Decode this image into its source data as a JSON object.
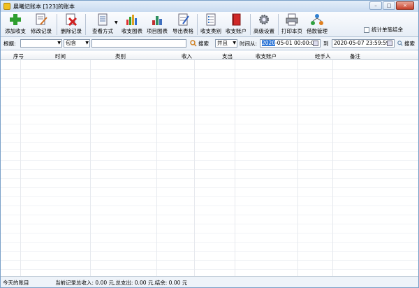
{
  "window": {
    "title": "晨曦记账本  [123]的账本",
    "buttons": {
      "minimize": "–",
      "maximize": "□",
      "close": "×"
    }
  },
  "toolbar": {
    "items": [
      {
        "label": "添加收支",
        "icon": "add-plus-icon"
      },
      {
        "label": "修改记录",
        "icon": "edit-record-icon"
      },
      {
        "label": "删除记录",
        "icon": "delete-record-icon"
      },
      {
        "label": "查看方式",
        "icon": "view-mode-icon"
      },
      {
        "label": "收支图表",
        "icon": "bar-chart-icon"
      },
      {
        "label": "项目图表",
        "icon": "item-chart-icon"
      },
      {
        "label": "导出表格",
        "icon": "export-table-icon"
      },
      {
        "label": "收支类别",
        "icon": "category-icon"
      },
      {
        "label": "收支账户",
        "icon": "account-book-icon"
      },
      {
        "label": "高级设置",
        "icon": "gear-icon"
      },
      {
        "label": "打印本页",
        "icon": "printer-icon"
      },
      {
        "label": "借款管理",
        "icon": "loan-network-icon"
      }
    ],
    "stat_checkbox_label": "统计单笔结余"
  },
  "filter": {
    "basis_label": "根据:",
    "basis_value": "",
    "match_value": "包含",
    "search_value": "",
    "search_label": "搜索",
    "logic_value": "并且",
    "time_from_label": "时间从:",
    "date_from_year": "2020",
    "date_from_rest": "-05-01 00:00:00",
    "to_label": "到",
    "date_to": "2020-05-07 23:59:59",
    "search2_label": "搜索"
  },
  "grid": {
    "columns": [
      "序号",
      "时间",
      "类别",
      "收入",
      "支出",
      "收支账户",
      "经手人",
      "备注"
    ]
  },
  "status": {
    "today": "今天的账目",
    "summary": "当前记录总收入: 0.00 元,总支出: 0.00 元,结余: 0.00 元"
  },
  "colors": {
    "accent": "#3078d8",
    "titlebar": "#c9dbf0",
    "close": "#c8422c"
  }
}
